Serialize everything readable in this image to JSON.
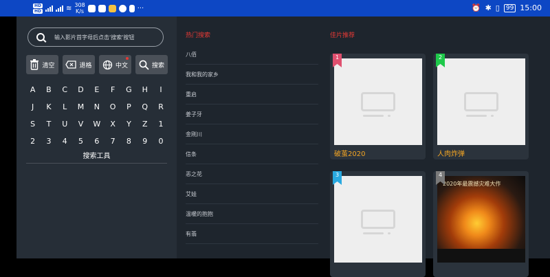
{
  "status_bar": {
    "network_speed": "308",
    "network_unit": "K/s",
    "battery": "99",
    "time": "15:00"
  },
  "search": {
    "placeholder": "输入影片首字母后点击'搜索'按钮"
  },
  "actions": {
    "clear": "清空",
    "backspace": "退格",
    "chinese": "中文",
    "search": "搜索"
  },
  "keyboard": {
    "rows": [
      [
        "A",
        "B",
        "C",
        "D",
        "E",
        "F",
        "G",
        "H",
        "I"
      ],
      [
        "J",
        "K",
        "L",
        "M",
        "N",
        "O",
        "P",
        "Q",
        "R"
      ],
      [
        "S",
        "T",
        "U",
        "V",
        "W",
        "X",
        "Y",
        "Z",
        "1"
      ],
      [
        "2",
        "3",
        "4",
        "5",
        "6",
        "7",
        "8",
        "9",
        "0"
      ]
    ]
  },
  "tools_label": "搜索工具",
  "hot_search": {
    "title": "热门搜索",
    "items": [
      "八佰",
      "我和我的家乡",
      "重启",
      "姜子牙",
      "金刚川",
      "信条",
      "恶之花",
      "艾娃",
      "温暖的抱抱",
      "有翡"
    ]
  },
  "recommendations": {
    "title": "佳片推荐",
    "items": [
      {
        "rank": "1",
        "title": "破茧2020",
        "badge_color": "#e0506f"
      },
      {
        "rank": "2",
        "title": "人肉炸弹",
        "badge_color": "#1ec94a"
      },
      {
        "rank": "3",
        "title": "",
        "badge_color": "#29a9e0"
      },
      {
        "rank": "4",
        "title": "",
        "badge_color": "#7a7a7a",
        "poster_text": "2020年最震撼灾难大作"
      }
    ]
  },
  "colors": {
    "status_bar": "#0d47c4",
    "accent_red": "#e53935",
    "title_orange": "#f5a623"
  }
}
